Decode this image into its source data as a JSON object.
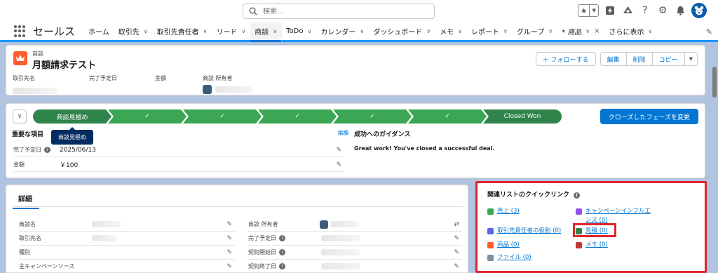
{
  "search": {
    "placeholder": "検索..."
  },
  "header_icons": [
    "star-icon",
    "add-icon",
    "trailhead-icon",
    "help-icon",
    "settings-icon",
    "bell-icon",
    "user-avatar"
  ],
  "app": {
    "name": "セールス"
  },
  "nav": {
    "tabs": [
      {
        "label": "ホーム",
        "chevron": false
      },
      {
        "label": "取引先",
        "chevron": true
      },
      {
        "label": "取引先責任者",
        "chevron": true
      },
      {
        "label": "リード",
        "chevron": true
      },
      {
        "label": "商談",
        "chevron": true,
        "active": true
      },
      {
        "label": "ToDo",
        "chevron": true
      },
      {
        "label": "カレンダー",
        "chevron": true
      },
      {
        "label": "ダッシュボード",
        "chevron": true
      },
      {
        "label": "メモ",
        "chevron": true
      },
      {
        "label": "レポート",
        "chevron": true
      },
      {
        "label": "グループ",
        "chevron": true
      },
      {
        "label": "* 商品",
        "chevron": true,
        "close": "×"
      },
      {
        "label": "さらに表示",
        "chevron": true
      }
    ]
  },
  "record": {
    "object_label": "商談",
    "title": "月額請求テスト",
    "actions": {
      "follow": "＋ フォローする",
      "edit": "編集",
      "delete": "削除",
      "copy": "コピー"
    },
    "fields": [
      {
        "label": "取引先名"
      },
      {
        "label": "完了予定日"
      },
      {
        "label": "金額"
      },
      {
        "label": "商談 所有者"
      }
    ]
  },
  "path": {
    "steps": [
      "商談見極め",
      "✓",
      "✓",
      "✓",
      "✓",
      "✓",
      "Closed Won"
    ],
    "mark_button": "クローズしたフェーズを変更",
    "tooltip": "商談見極め",
    "key_fields_title": "重要な項目",
    "edit_link": "編集",
    "key_fields": [
      {
        "label": "完了予定日",
        "value": "2025/06/13",
        "info": true
      },
      {
        "label": "金額",
        "value": "￥100",
        "info": false
      }
    ],
    "guidance_title": "成功へのガイダンス",
    "guidance_text": "Great work! You've closed a successful deal."
  },
  "details": {
    "tab": "詳細",
    "left_fields": [
      "商談名",
      "取引先名",
      "種別",
      "主キャンペーンソース"
    ],
    "right_fields": [
      "商談 所有者",
      "完了予定日",
      "契約開始日",
      "契約終了日"
    ],
    "right_info": [
      false,
      true,
      true,
      true
    ]
  },
  "quick_links": {
    "title": "関連リストのクイックリンク",
    "items": [
      {
        "label": "売上 (3)",
        "color": "#3ba755"
      },
      {
        "label": "キャンペーンインフルエンス (0)",
        "color": "#9050e9",
        "line1": "キャンペーンインフルエ",
        "line2": "ンス (0)"
      },
      {
        "label": "取引先責任者の役割 (0)",
        "color": "#5867e8"
      },
      {
        "label": "見積 (0)",
        "color": "#2e844a"
      },
      {
        "label": "商品 (0)",
        "color": "#ff5d2d"
      },
      {
        "label": "メモ (0)",
        "color": "#c23934"
      },
      {
        "label": "ファイル (0)",
        "color": "#7f8ea3"
      }
    ]
  },
  "colors": {
    "brand": "#0176d3",
    "path_complete": "#3ba755",
    "highlight": "#e0242d",
    "page_bg": "#b0c4df"
  }
}
